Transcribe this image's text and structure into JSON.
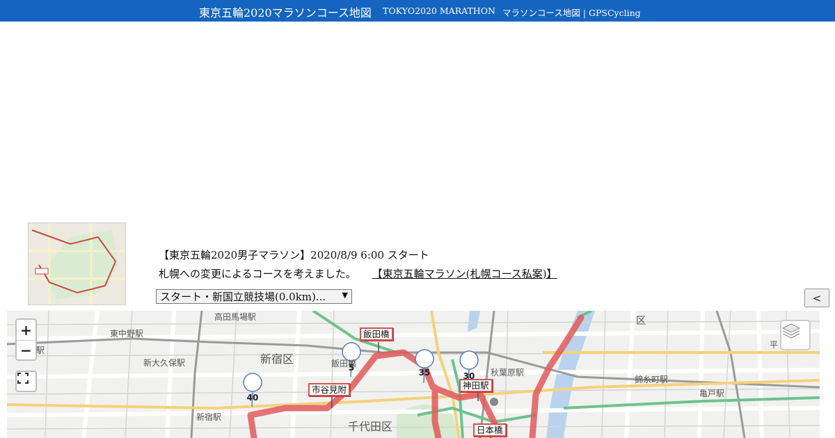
{
  "header": {
    "title": "東京五輪2020マラソンコース地図",
    "subtitle_en": "TOKYO2020 MARATHON",
    "site": "マラソンコース地図 | GPSCycling"
  },
  "info": {
    "line1": "【東京五輪2020男子マラソン】2020/8/9 6:00 スタート",
    "line2": "札幌への変更によるコースを考えました。",
    "link": "【東京五輪マラソン(札幌コース私案)】"
  },
  "controls": {
    "select_value": "スタート・新国立競技場(0.0km)...",
    "back_button": "<"
  },
  "map": {
    "zoom_in": "+",
    "zoom_out": "−",
    "districts": [
      "新宿区",
      "千代田区",
      "区"
    ],
    "stations": [
      "高田馬場駅",
      "東中野駅",
      "新大久保駅",
      "新宿駅",
      "秋葉原駅",
      "錦糸町駅",
      "飯田橋",
      "駅",
      "亀戸駅",
      "平"
    ],
    "landmarks": [
      "飯田橋",
      "市谷見附",
      "神田駅",
      "日本橋"
    ],
    "km_markers": [
      "5",
      "30",
      "35",
      "40"
    ],
    "route_color": "#e05a5a"
  }
}
